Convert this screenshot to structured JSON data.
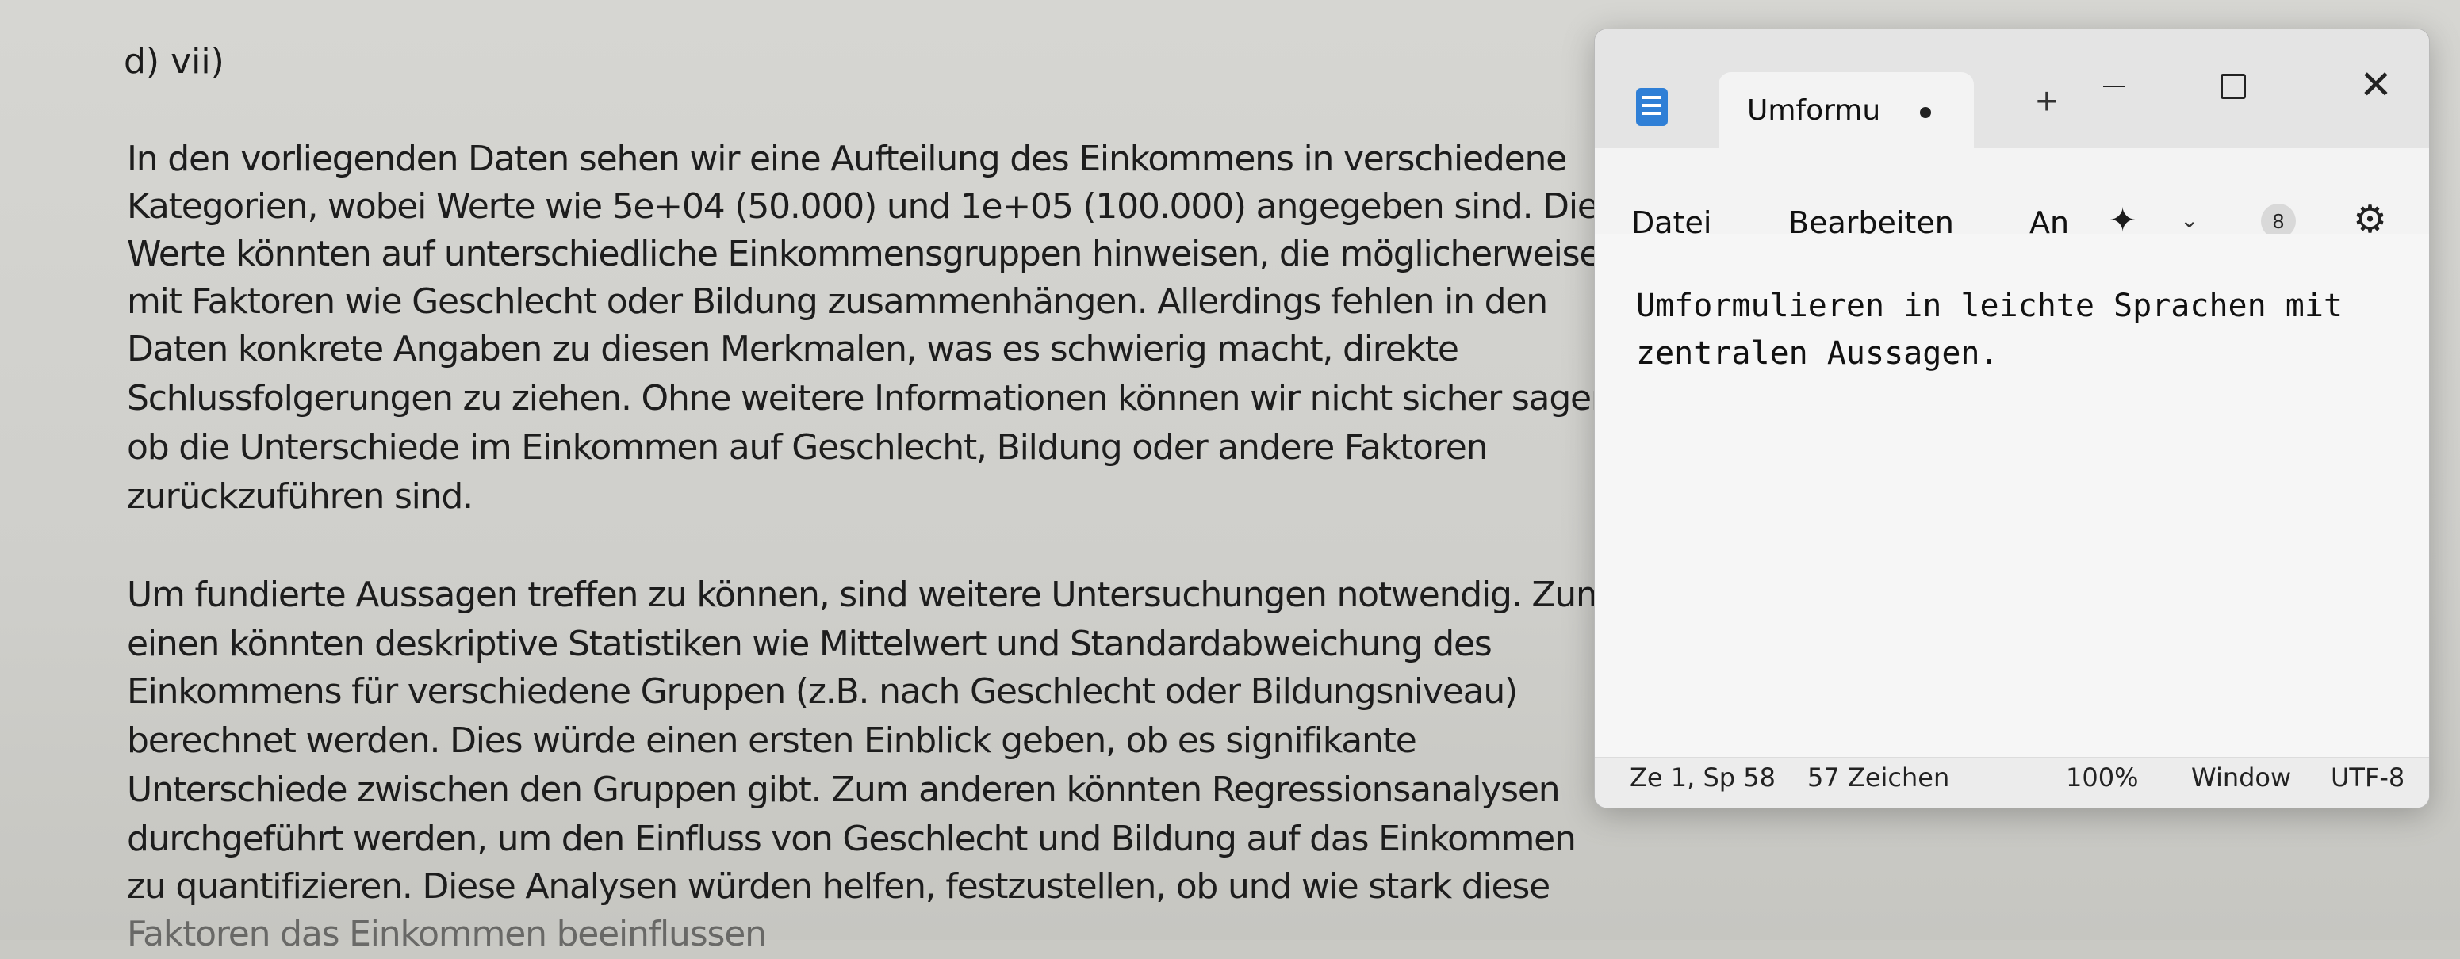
{
  "document": {
    "heading": "d) vii)",
    "lines": [
      "In den vorliegenden Daten sehen wir eine Aufteilung des Einkommens in verschiedene",
      "Kategorien, wobei Werte wie 5e+04 (50.000) und 1e+05 (100.000) angegeben sind. Diese",
      "Werte könnten auf unterschiedliche Einkommensgruppen hinweisen, die möglicherweise",
      "mit Faktoren wie Geschlecht oder Bildung zusammenhängen. Allerdings fehlen in den",
      "Daten konkrete Angaben zu diesen Merkmalen, was es schwierig macht, direkte",
      "Schlussfolgerungen zu ziehen. Ohne weitere Informationen können wir nicht sicher sagen,",
      "ob die Unterschiede im Einkommen auf Geschlecht, Bildung oder andere Faktoren",
      "zurückzuführen sind.",
      "Um fundierte Aussagen treffen zu können, sind weitere Untersuchungen notwendig. Zum",
      "einen könnten deskriptive Statistiken wie Mittelwert und Standardabweichung des",
      "Einkommens für verschiedene Gruppen (z.B. nach Geschlecht oder Bildungsniveau)",
      "berechnet werden. Dies würde einen ersten Einblick geben, ob es signifikante",
      "Unterschiede zwischen den Gruppen gibt. Zum anderen könnten Regressionsanalysen",
      "durchgeführt werden, um den Einfluss von Geschlecht und Bildung auf das Einkommen",
      "zu quantifizieren. Diese Analysen würden helfen, festzustellen, ob und wie stark diese",
      "Faktoren das Einkommen beeinflussen"
    ]
  },
  "notepad": {
    "tab_title": "Umformu",
    "new_tab_symbol": "+",
    "window_controls": {
      "minimize": "",
      "maximize": "",
      "close": "✕"
    },
    "menu": {
      "datei": "Datei",
      "bearbeiten": "Bearbeiten",
      "ansicht": "An"
    },
    "icons": {
      "app": "notepad-icon",
      "copilot": "copilot-icon",
      "dropdown": "chevron-down-icon",
      "account": "account-icon",
      "settings": "gear-icon"
    },
    "icon_glyphs": {
      "copilot": "✦",
      "dropdown": "⌄",
      "account": "8",
      "settings": "⚙"
    },
    "editor_lines": [
      "Umformulieren in leichte Sprachen mit",
      "zentralen Aussagen."
    ],
    "status": {
      "position": "Ze 1, Sp 58",
      "chars": "57 Zeichen",
      "zoom": "100%",
      "eol": "Window",
      "encoding": "UTF-8"
    }
  }
}
